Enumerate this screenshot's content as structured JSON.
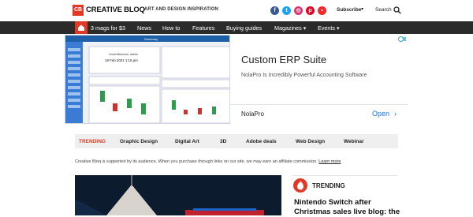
{
  "header": {
    "logo_mark": "CB",
    "logo_text": "CREATIVE BLOQ",
    "tagline": "ART AND DESIGN INSPIRATION",
    "subscribe_label": "Subscribe",
    "search_label": "Search",
    "social": [
      "facebook-icon",
      "twitter-icon",
      "instagram-icon",
      "pinterest-icon",
      "flipboard-icon"
    ]
  },
  "nav": {
    "items": [
      "3 mags for $3",
      "News",
      "How to",
      "Features",
      "Buying guides",
      "Magazines ▾",
      "Events ▾"
    ]
  },
  "ad": {
    "app_title": "Summary",
    "app_user": "Good Afternoon, Admin",
    "app_date": "18 Feb 2021 1:16 pm",
    "headline": "Custom ERP Suite",
    "description": "NolaPro Is Incredibly Powerful Accounting Software",
    "brand": "NolaPro",
    "cta": "Open"
  },
  "trending": {
    "items": [
      "TRENDING",
      "Graphic Design",
      "Digital Art",
      "3D",
      "Adobe deals",
      "Web Design",
      "Webinar"
    ]
  },
  "disclaimer": {
    "text": "Creative Bloq is supported by its audience. When you purchase through links on our site, we may earn an affiliate commission.",
    "link": "Learn more"
  },
  "sidebar": {
    "label": "TRENDING",
    "headline": "Nintendo Switch after Christmas sales live blog: the"
  },
  "colors": {
    "brand": "#e03a27",
    "nav_bg": "#2b2b2b",
    "link": "#1a73e8"
  }
}
